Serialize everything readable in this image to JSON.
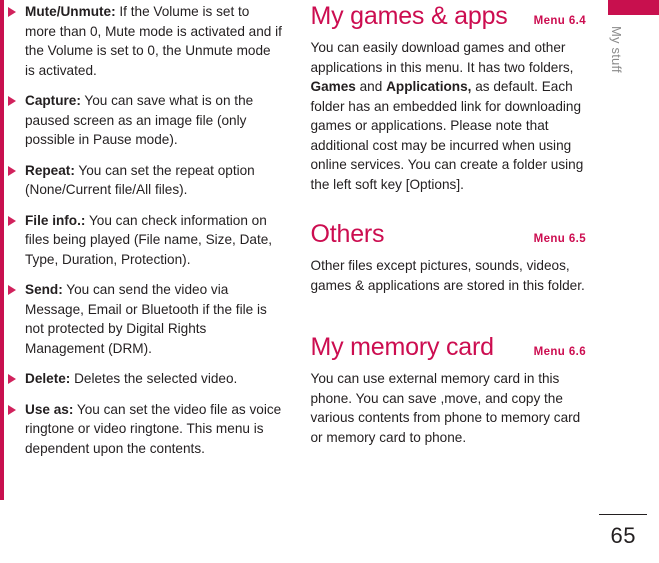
{
  "page": {
    "number": "65",
    "side_tab_label": "My stuff",
    "accent_color": "#C8104E",
    "heading_color": "#CC0D50",
    "body_color": "#231F20"
  },
  "left_column": {
    "bullets": [
      {
        "term": "Mute/Unmute:",
        "text": " If the Volume is set to more than 0, Mute mode is activated and if the Volume is set to 0, the Unmute mode is activated."
      },
      {
        "term": "Capture:",
        "text": " You can save what is on the paused screen as an image file (only possible in Pause mode)."
      },
      {
        "term": "Repeat:",
        "text": " You can set the repeat option (None/Current file/All files)."
      },
      {
        "term": "File info.:",
        "text": " You can check information on files being played (File name, Size, Date, Type, Duration, Protection)."
      },
      {
        "term": "Send:",
        "text": " You can send the video via Message,  Email or Bluetooth if the file is not protected by Digital Rights Management (DRM)."
      },
      {
        "term": "Delete:",
        "text": " Deletes the selected video."
      },
      {
        "term": "Use as:",
        "text": " You can set the video file as voice ringtone or video ringtone. This menu is dependent upon the contents."
      }
    ]
  },
  "right_column": {
    "sections": [
      {
        "title": "My games & apps",
        "menu": "Menu 6.4",
        "body_pre": "You can easily download games and other applications in this menu. It has two folders, ",
        "bold_1": "Games",
        "body_mid": " and ",
        "bold_2": "Applications,",
        "body_post": " as default. Each folder has an embedded link for downloading games or applications. Please note that additional cost may be incurred when using online services. You can create a folder using the left soft key [Options]."
      },
      {
        "title": "Others",
        "menu": "Menu 6.5",
        "body": "Other files except pictures, sounds, videos, games & applications are stored in this folder."
      },
      {
        "title": "My memory card",
        "menu": "Menu 6.6",
        "body": "You can use external memory card in this phone. You can save ,move, and copy the various contents from phone to memory card or memory card to phone."
      }
    ]
  }
}
